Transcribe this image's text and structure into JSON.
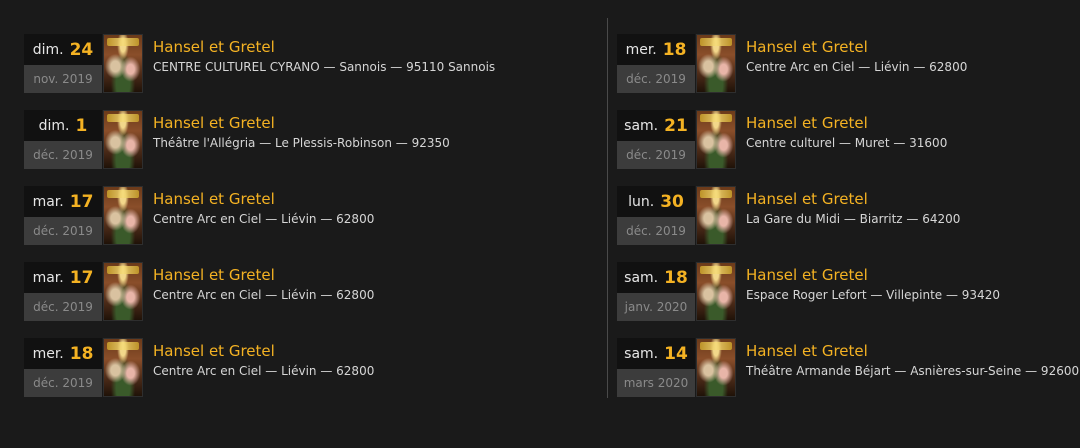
{
  "left_events": [
    {
      "dow": "dim.",
      "day": "24",
      "month": "nov. 2019",
      "title": "Hansel et Gretel",
      "venue": "CENTRE CULTUREL CYRANO — Sannois — 95110 Sannois"
    },
    {
      "dow": "dim.",
      "day": "1",
      "month": "déc. 2019",
      "title": "Hansel et Gretel",
      "venue": "Théâtre l'Allégria — Le Plessis-Robinson — 92350"
    },
    {
      "dow": "mar.",
      "day": "17",
      "month": "déc. 2019",
      "title": "Hansel et Gretel",
      "venue": "Centre Arc en Ciel — Liévin — 62800"
    },
    {
      "dow": "mar.",
      "day": "17",
      "month": "déc. 2019",
      "title": "Hansel et Gretel",
      "venue": "Centre Arc en Ciel — Liévin — 62800"
    },
    {
      "dow": "mer.",
      "day": "18",
      "month": "déc. 2019",
      "title": "Hansel et Gretel",
      "venue": "Centre Arc en Ciel — Liévin — 62800"
    }
  ],
  "right_events": [
    {
      "dow": "mer.",
      "day": "18",
      "month": "déc. 2019",
      "title": "Hansel et Gretel",
      "venue": "Centre Arc en Ciel — Liévin — 62800"
    },
    {
      "dow": "sam.",
      "day": "21",
      "month": "déc. 2019",
      "title": "Hansel et Gretel",
      "venue": "Centre culturel — Muret — 31600"
    },
    {
      "dow": "lun.",
      "day": "30",
      "month": "déc. 2019",
      "title": "Hansel et Gretel",
      "venue": "La Gare du Midi — Biarritz — 64200"
    },
    {
      "dow": "sam.",
      "day": "18",
      "month": "janv. 2020",
      "title": "Hansel et Gretel",
      "venue": "Espace Roger Lefort — Villepinte — 93420"
    },
    {
      "dow": "sam.",
      "day": "14",
      "month": "mars 2020",
      "title": "Hansel et Gretel",
      "venue": "Théâtre Armande Béjart — Asnières-sur-Seine — 92600"
    }
  ],
  "colors": {
    "accent": "#f4b223",
    "background": "#1a1a1a",
    "date_top_bg": "#111111",
    "date_bottom_bg": "#3c3c3c"
  },
  "icons": {
    "thumbnail": "poster-thumbnail-image"
  }
}
